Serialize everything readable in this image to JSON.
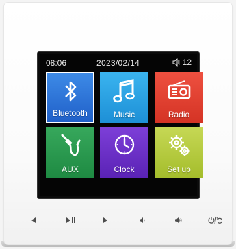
{
  "status": {
    "time": "08:06",
    "date": "2023/02/14",
    "volume": "12"
  },
  "tiles": [
    {
      "label": "Bluetooth",
      "icon": "bluetooth-icon",
      "color": "#2f76dc"
    },
    {
      "label": "Music",
      "icon": "music-note-icon",
      "color": "#2aa2e4"
    },
    {
      "label": "Radio",
      "icon": "radio-icon",
      "color": "#e24233"
    },
    {
      "label": "AUX",
      "icon": "aux-cable-icon",
      "color": "#2c9a4f"
    },
    {
      "label": "Clock",
      "icon": "clock-icon",
      "color": "#6b30c9"
    },
    {
      "label": "Set up",
      "icon": "gear-icon",
      "color": "#b7cc3f"
    }
  ],
  "hardware_buttons": [
    {
      "icon": "previous-icon",
      "glyph": "◄"
    },
    {
      "icon": "play-pause-icon",
      "glyph": "▶II"
    },
    {
      "icon": "next-icon",
      "glyph": "►"
    },
    {
      "icon": "volume-down-icon",
      "glyph": "◂)"
    },
    {
      "icon": "volume-up-icon",
      "glyph": "◂))"
    },
    {
      "icon": "power-back-icon",
      "glyph": "⏻/⮌"
    }
  ]
}
